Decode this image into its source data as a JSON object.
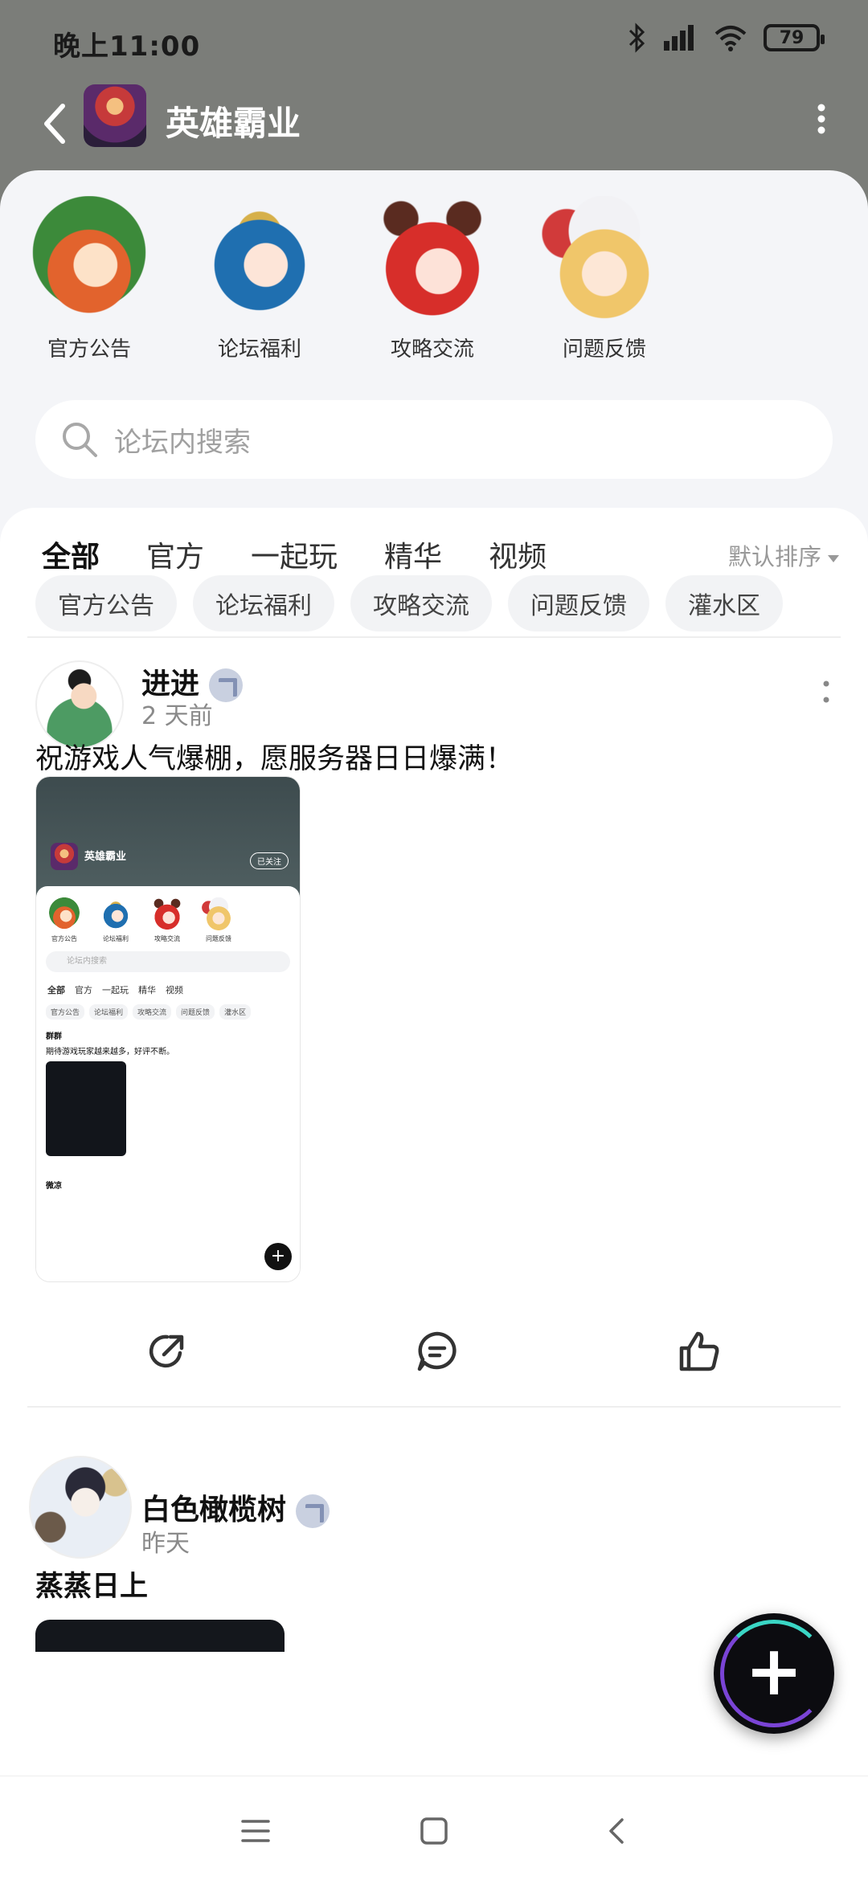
{
  "status_bar": {
    "time": "晚上11:00",
    "battery": "79"
  },
  "header": {
    "title": "英雄霸业"
  },
  "categories": [
    {
      "label": "官方公告"
    },
    {
      "label": "论坛福利"
    },
    {
      "label": "攻略交流"
    },
    {
      "label": "问题反馈"
    }
  ],
  "search": {
    "placeholder": "论坛内搜索"
  },
  "tabs": [
    {
      "label": "全部",
      "active": true
    },
    {
      "label": "官方"
    },
    {
      "label": "一起玩"
    },
    {
      "label": "精华"
    },
    {
      "label": "视频"
    }
  ],
  "sort": {
    "label": "默认排序"
  },
  "chips": [
    "官方公告",
    "论坛福利",
    "攻略交流",
    "问题反馈",
    "灌水区"
  ],
  "posts": [
    {
      "username": "进进",
      "time": "2 天前",
      "text": "祝游戏人气爆棚，愿服务器日日爆满！",
      "screenshot": {
        "title": "英雄霸业",
        "follow": "已关注",
        "categories": [
          "官方公告",
          "论坛福利",
          "攻略交流",
          "问题反馈"
        ],
        "search": "论坛内搜索",
        "tabs": [
          "全部",
          "官方",
          "一起玩",
          "精华",
          "视频"
        ],
        "chips": [
          "官方公告",
          "论坛福利",
          "攻略交流",
          "问题反馈",
          "灌水区"
        ],
        "post_user": "群群",
        "post_text": "期待游戏玩家越来越多，好评不断。",
        "second_user": "微凉"
      }
    },
    {
      "username": "白色橄榄树",
      "time": "昨天",
      "text": "蒸蒸日上"
    }
  ],
  "icons": {
    "back": "chevron-left",
    "more": "vertical-dots",
    "search": "magnifier",
    "share": "share-arrow",
    "comment": "chat-bubble",
    "like": "thumbs-up",
    "fab": "plus"
  },
  "colors": {
    "accent": "#2fd3c9",
    "header_bg": "#7b7d79",
    "fab_bg": "#0c0c10"
  }
}
